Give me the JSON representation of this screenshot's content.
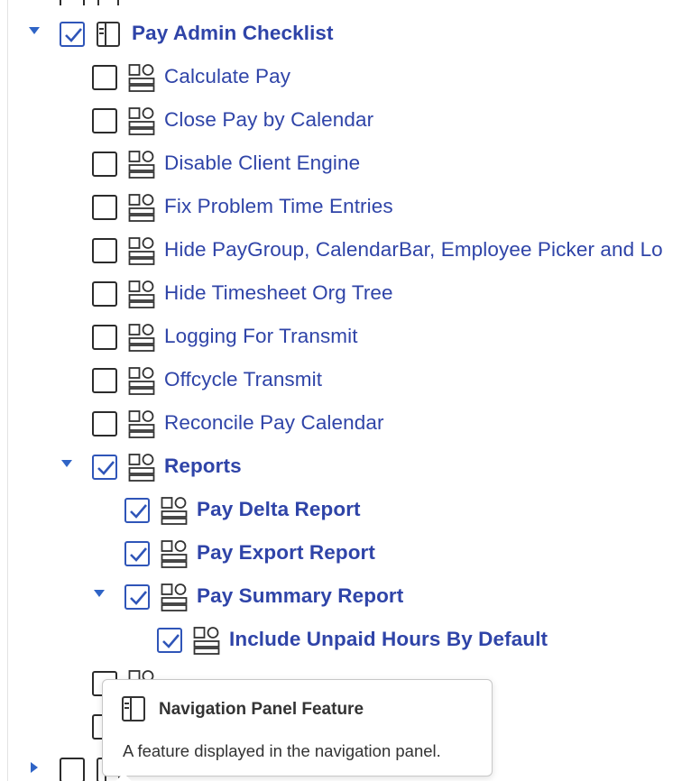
{
  "tree": {
    "root": {
      "label": "Pay Admin Checklist",
      "checked": true,
      "expanded": true,
      "icon": "navigation-panel-icon"
    },
    "items": [
      {
        "label": "Calculate Pay",
        "checked": false
      },
      {
        "label": "Close Pay by Calendar",
        "checked": false
      },
      {
        "label": "Disable Client Engine",
        "checked": false
      },
      {
        "label": "Fix Problem Time Entries",
        "checked": false
      },
      {
        "label": "Hide PayGroup, CalendarBar, Employee Picker and Lo",
        "checked": false
      },
      {
        "label": "Hide Timesheet Org Tree",
        "checked": false
      },
      {
        "label": "Logging For Transmit",
        "checked": false
      },
      {
        "label": "Offcycle Transmit",
        "checked": false
      },
      {
        "label": "Reconcile Pay Calendar",
        "checked": false
      }
    ],
    "reports": {
      "label": "Reports",
      "checked": true,
      "expanded": true,
      "children": [
        {
          "label": "Pay Delta Report",
          "checked": true
        },
        {
          "label": "Pay Export Report",
          "checked": true
        },
        {
          "label": "Pay Summary Report",
          "checked": true,
          "expanded": true,
          "children": [
            {
              "label": "Include Unpaid Hours By Default",
              "checked": true
            }
          ]
        }
      ]
    }
  },
  "tooltip": {
    "title": "Navigation Panel Feature",
    "description": "A feature displayed in the navigation panel."
  },
  "colors": {
    "accent": "#2f44a8",
    "caret": "#2f64c6",
    "checkbox_border": "#2b2b2b"
  }
}
